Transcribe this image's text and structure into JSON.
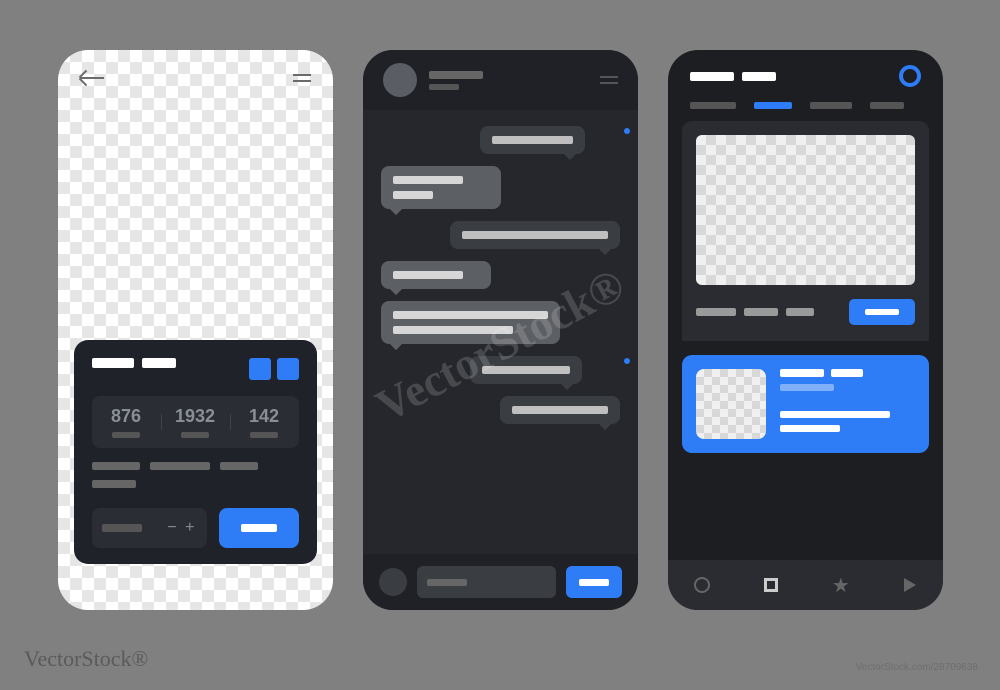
{
  "phone1": {
    "stats": [
      {
        "value": "876"
      },
      {
        "value": "1932"
      },
      {
        "value": "142"
      }
    ],
    "stepper_pm": "− +"
  },
  "watermark": {
    "brand": "VectorStock®",
    "site": "VectorStock.com/28709638"
  }
}
